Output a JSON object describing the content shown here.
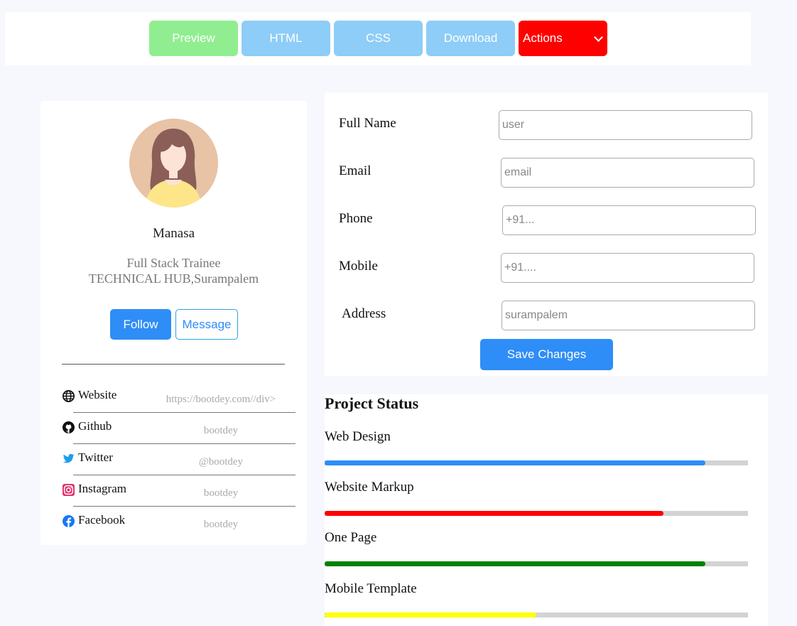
{
  "toolbar": {
    "preview": "Preview",
    "html": "HTML",
    "css": "CSS",
    "download": "Download",
    "actions": "Actions"
  },
  "profile": {
    "name": "Manasa",
    "title": "Full Stack Trainee",
    "org": "TECHNICAL HUB,Surampalem",
    "follow": "Follow",
    "message": "Message",
    "social": [
      {
        "icon": "globe-icon",
        "label": "Website",
        "value": "https://bootdey.com//div>"
      },
      {
        "icon": "github-icon",
        "label": "Github",
        "value": "bootdey"
      },
      {
        "icon": "twitter-icon",
        "label": "Twitter",
        "value": "@bootdey"
      },
      {
        "icon": "instagram-icon",
        "label": "Instagram",
        "value": "bootdey"
      },
      {
        "icon": "facebook-icon",
        "label": "Facebook",
        "value": "bootdey"
      }
    ]
  },
  "form": {
    "fields": [
      {
        "label": "Full Name",
        "placeholder": "user",
        "value": ""
      },
      {
        "label": "Email",
        "placeholder": "email",
        "value": ""
      },
      {
        "label": "Phone",
        "placeholder": "+91...",
        "value": ""
      },
      {
        "label": "Mobile",
        "placeholder": "+91....",
        "value": ""
      },
      {
        "label": "Address",
        "placeholder": "surampalem",
        "value": ""
      }
    ],
    "save": "Save Changes"
  },
  "projects": {
    "title": "Project Status",
    "items": [
      {
        "label": "Web Design",
        "progress": 0.9,
        "color": "#2e8df7"
      },
      {
        "label": "Website Markup",
        "progress": 0.8,
        "color": "#ff0000"
      },
      {
        "label": "One Page",
        "progress": 0.9,
        "color": "#008000"
      },
      {
        "label": "Mobile Template",
        "progress": 0.5,
        "color": "#ffff00"
      }
    ]
  },
  "colors": {
    "primary": "#2e8df7",
    "actions": "#ff0000",
    "preview": "#90ee90",
    "toolbar_button": "#8dcdf7"
  }
}
